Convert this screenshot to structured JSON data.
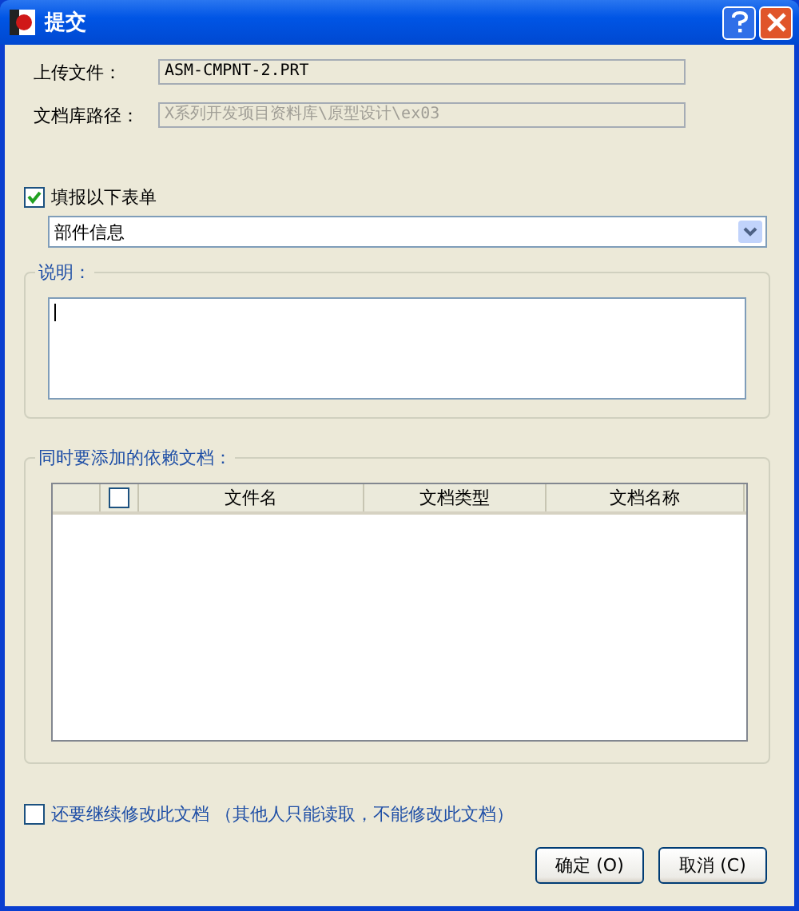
{
  "window": {
    "title": "提交"
  },
  "fields": [
    {
      "label": "上传文件：",
      "value": "ASM-CMPNT-2.PRT",
      "disabled": false
    },
    {
      "label": "文档库路径：",
      "value": "X系列开发项目资料库\\原型设计\\ex03",
      "disabled": true
    }
  ],
  "fill_form": {
    "label": "填报以下表单",
    "checked": true
  },
  "form_select": {
    "value": "部件信息"
  },
  "description": {
    "label": "说明："
  },
  "dependencies": {
    "label": "同时要添加的依赖文档：",
    "header_checkbox": {
      "checked": false
    },
    "columns": [
      "文件名",
      "文档类型",
      "文档名称"
    ]
  },
  "keep_editing": {
    "label": "还要继续修改此文档 （其他人只能读取，不能修改此文档）",
    "checked": false
  },
  "buttons": [
    "确定 (O)",
    "取消 (C)"
  ]
}
